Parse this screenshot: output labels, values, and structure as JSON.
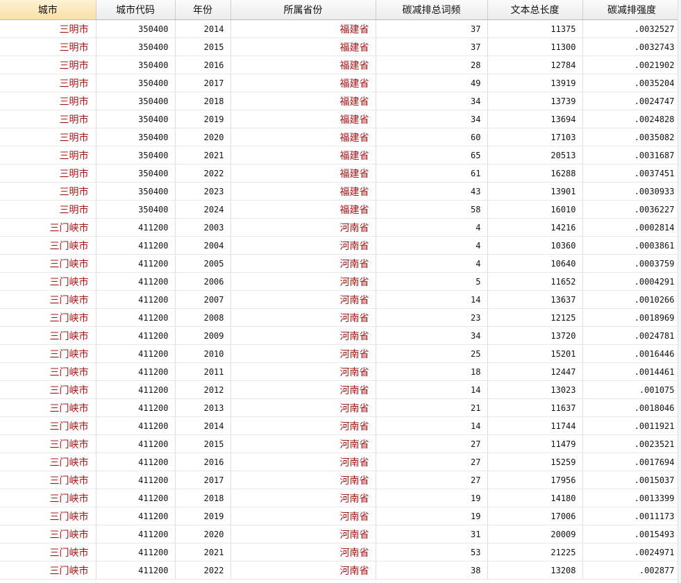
{
  "columns": [
    "城市",
    "城市代码",
    "年份",
    "所属省份",
    "碳减排总词频",
    "文本总长度",
    "碳减排强度"
  ],
  "rows": [
    [
      "三明市",
      "350400",
      "2014",
      "福建省",
      "37",
      "11375",
      ".0032527"
    ],
    [
      "三明市",
      "350400",
      "2015",
      "福建省",
      "37",
      "11300",
      ".0032743"
    ],
    [
      "三明市",
      "350400",
      "2016",
      "福建省",
      "28",
      "12784",
      ".0021902"
    ],
    [
      "三明市",
      "350400",
      "2017",
      "福建省",
      "49",
      "13919",
      ".0035204"
    ],
    [
      "三明市",
      "350400",
      "2018",
      "福建省",
      "34",
      "13739",
      ".0024747"
    ],
    [
      "三明市",
      "350400",
      "2019",
      "福建省",
      "34",
      "13694",
      ".0024828"
    ],
    [
      "三明市",
      "350400",
      "2020",
      "福建省",
      "60",
      "17103",
      ".0035082"
    ],
    [
      "三明市",
      "350400",
      "2021",
      "福建省",
      "65",
      "20513",
      ".0031687"
    ],
    [
      "三明市",
      "350400",
      "2022",
      "福建省",
      "61",
      "16288",
      ".0037451"
    ],
    [
      "三明市",
      "350400",
      "2023",
      "福建省",
      "43",
      "13901",
      ".0030933"
    ],
    [
      "三明市",
      "350400",
      "2024",
      "福建省",
      "58",
      "16010",
      ".0036227"
    ],
    [
      "三门峡市",
      "411200",
      "2003",
      "河南省",
      "4",
      "14216",
      ".0002814"
    ],
    [
      "三门峡市",
      "411200",
      "2004",
      "河南省",
      "4",
      "10360",
      ".0003861"
    ],
    [
      "三门峡市",
      "411200",
      "2005",
      "河南省",
      "4",
      "10640",
      ".0003759"
    ],
    [
      "三门峡市",
      "411200",
      "2006",
      "河南省",
      "5",
      "11652",
      ".0004291"
    ],
    [
      "三门峡市",
      "411200",
      "2007",
      "河南省",
      "14",
      "13637",
      ".0010266"
    ],
    [
      "三门峡市",
      "411200",
      "2008",
      "河南省",
      "23",
      "12125",
      ".0018969"
    ],
    [
      "三门峡市",
      "411200",
      "2009",
      "河南省",
      "34",
      "13720",
      ".0024781"
    ],
    [
      "三门峡市",
      "411200",
      "2010",
      "河南省",
      "25",
      "15201",
      ".0016446"
    ],
    [
      "三门峡市",
      "411200",
      "2011",
      "河南省",
      "18",
      "12447",
      ".0014461"
    ],
    [
      "三门峡市",
      "411200",
      "2012",
      "河南省",
      "14",
      "13023",
      ".001075"
    ],
    [
      "三门峡市",
      "411200",
      "2013",
      "河南省",
      "21",
      "11637",
      ".0018046"
    ],
    [
      "三门峡市",
      "411200",
      "2014",
      "河南省",
      "14",
      "11744",
      ".0011921"
    ],
    [
      "三门峡市",
      "411200",
      "2015",
      "河南省",
      "27",
      "11479",
      ".0023521"
    ],
    [
      "三门峡市",
      "411200",
      "2016",
      "河南省",
      "27",
      "15259",
      ".0017694"
    ],
    [
      "三门峡市",
      "411200",
      "2017",
      "河南省",
      "27",
      "17956",
      ".0015037"
    ],
    [
      "三门峡市",
      "411200",
      "2018",
      "河南省",
      "19",
      "14180",
      ".0013399"
    ],
    [
      "三门峡市",
      "411200",
      "2019",
      "河南省",
      "19",
      "17006",
      ".0011173"
    ],
    [
      "三门峡市",
      "411200",
      "2020",
      "河南省",
      "31",
      "20009",
      ".0015493"
    ],
    [
      "三门峡市",
      "411200",
      "2021",
      "河南省",
      "53",
      "21225",
      ".0024971"
    ],
    [
      "三门峡市",
      "411200",
      "2022",
      "河南省",
      "38",
      "13208",
      ".002877"
    ]
  ]
}
